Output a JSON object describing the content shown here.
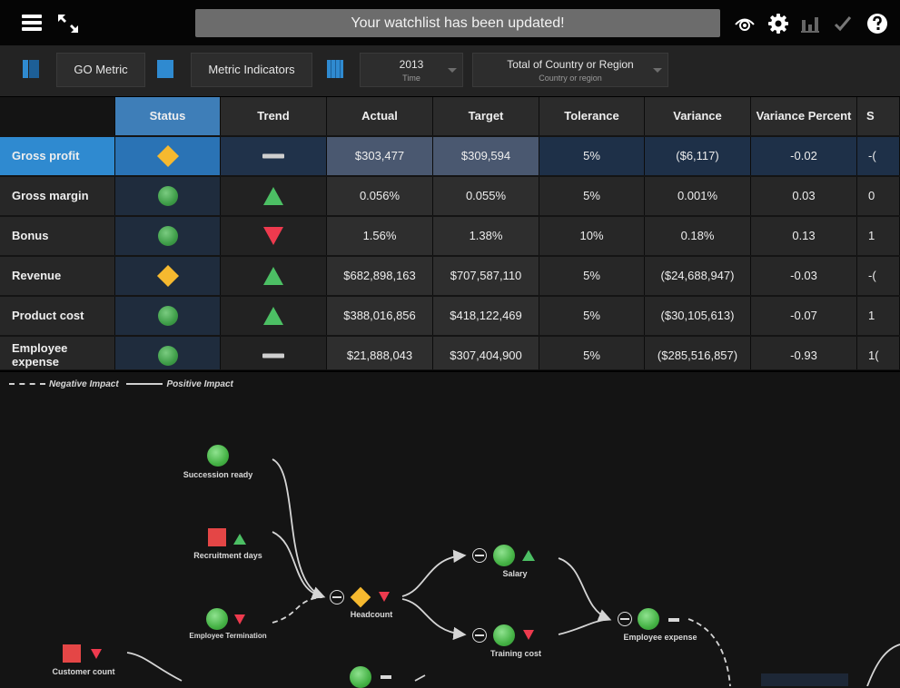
{
  "toolbar": {
    "notification": "Your watchlist has been updated!",
    "icons": [
      "menu-icon",
      "collapse-icon",
      "eye-icon",
      "gear-icon",
      "bar-chart-icon",
      "checkmark-icon",
      "help-icon"
    ]
  },
  "filters": {
    "metric_button": "GO Metric",
    "indicators_button": "Metric Indicators",
    "time": {
      "value": "2013",
      "label": "Time"
    },
    "region": {
      "value": "Total of Country or Region",
      "label": "Country or region"
    }
  },
  "table": {
    "columns": [
      "Status",
      "Trend",
      "Actual",
      "Target",
      "Tolerance",
      "Variance",
      "Variance Percent",
      "S"
    ],
    "rows": [
      {
        "name": "Gross profit",
        "status": "diamond",
        "trend": "flat",
        "actual": "$303,477",
        "target": "$309,594",
        "tolerance": "5%",
        "variance": "($6,117)",
        "variance_percent": "-0.02",
        "s": "-("
      },
      {
        "name": "Gross margin",
        "status": "circle",
        "trend": "up",
        "actual": "0.056%",
        "target": "0.055%",
        "tolerance": "5%",
        "variance": "0.001%",
        "variance_percent": "0.03",
        "s": "0"
      },
      {
        "name": "Bonus",
        "status": "circle",
        "trend": "down",
        "actual": "1.56%",
        "target": "1.38%",
        "tolerance": "10%",
        "variance": "0.18%",
        "variance_percent": "0.13",
        "s": "1"
      },
      {
        "name": "Revenue",
        "status": "diamond",
        "trend": "up",
        "actual": "$682,898,163",
        "target": "$707,587,110",
        "tolerance": "5%",
        "variance": "($24,688,947)",
        "variance_percent": "-0.03",
        "s": "-("
      },
      {
        "name": "Product cost",
        "status": "circle",
        "trend": "up",
        "actual": "$388,016,856",
        "target": "$418,122,469",
        "tolerance": "5%",
        "variance": "($30,105,613)",
        "variance_percent": "-0.07",
        "s": "1"
      },
      {
        "name": "Employee expense",
        "status": "circle",
        "trend": "flat",
        "actual": "$21,888,043",
        "target": "$307,404,900",
        "tolerance": "5%",
        "variance": "($285,516,857)",
        "variance_percent": "-0.93",
        "s": "1("
      }
    ]
  },
  "diagram": {
    "legend_negative": "Negative Impact",
    "legend_positive": "Positive Impact",
    "nodes": {
      "succession_ready": "Succession ready",
      "recruitment_days": "Recruitment days",
      "employee_termination": "Employee Termination",
      "headcount": "Headcount",
      "salary": "Salary",
      "training_cost": "Training cost",
      "employee_expense": "Employee expense",
      "customer_count": "Customer count"
    }
  },
  "colors": {
    "accent": "#2f8ad0",
    "status_green": "#45b245",
    "status_yellow": "#f6b92f",
    "trend_up": "#4cbf64",
    "trend_down": "#ee3a4e",
    "status_red": "#e44646"
  }
}
